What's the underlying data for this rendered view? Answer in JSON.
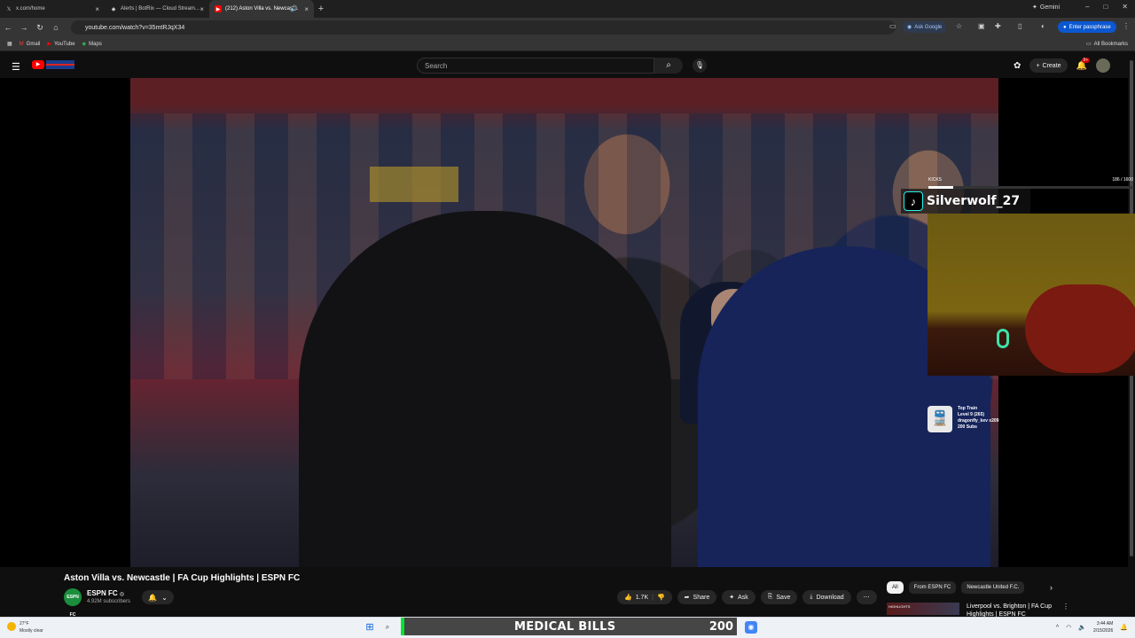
{
  "browser": {
    "tabs": [
      {
        "title": "x.com/home",
        "icon": "x-logo-icon"
      },
      {
        "title": "Alerts | BotRix — Cloud Stream...",
        "icon": "botrix-icon"
      },
      {
        "title": "(212) Aston Villa vs. Newcast...",
        "icon": "youtube-icon"
      }
    ],
    "gemini_label": "Gemini",
    "url": "youtube.com/watch?v=35mtRJqX34",
    "ask_google": "Ask Google",
    "passphrase": "Enter passphrase",
    "bookmarks": [
      "Gmail",
      "YouTube",
      "Maps"
    ],
    "all_bookmarks": "All Bookmarks"
  },
  "youtube": {
    "search_placeholder": "Search",
    "create_label": "Create",
    "notif_count": "9+"
  },
  "overlays": {
    "kicks_label": "KICKS",
    "kicks_count": "186 / 1600",
    "kicks_progress": 0.12,
    "tiktok_name": "Silverwolf_27",
    "train_lines": [
      "Top Train",
      "Level 9 (265)",
      "dragonfly_kev x209",
      "200 Subs"
    ]
  },
  "video": {
    "title": "Aston Villa vs. Newcastle | FA Cup Highlights | ESPN FC",
    "channel": "ESPN FC",
    "channel_avatar": "ESPN FC",
    "verified": "◎",
    "subscribers": "4.92M subscribers",
    "likes": "1.7K",
    "share": "Share",
    "ask": "Ask",
    "save": "Save",
    "download": "Download"
  },
  "sidebar": {
    "chips": [
      "All",
      "From ESPN FC",
      "Newcastle United F.C."
    ],
    "reco_title": "Liverpool vs. Brighton | FA Cup Highlights | ESPN FC",
    "reco_thumb": "HIGHLIGHTS"
  },
  "taskbar": {
    "temp": "27°F",
    "weather": "Mostly clear",
    "overlay_text": "MEDICAL BILLS",
    "overlay_count": "200",
    "time": "3:44 AM",
    "date": "2/15/2026"
  }
}
